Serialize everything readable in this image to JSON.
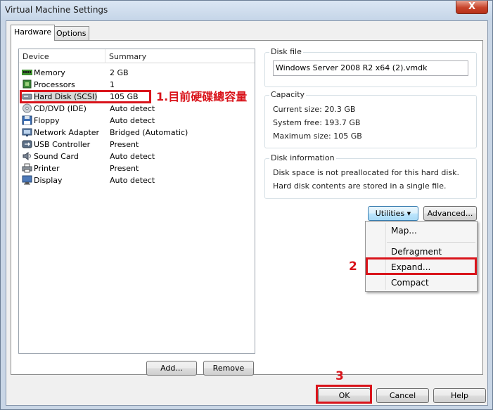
{
  "window": {
    "title": "Virtual Machine Settings",
    "close_label": "X"
  },
  "tabs": [
    {
      "label": "Hardware"
    },
    {
      "label": "Options"
    }
  ],
  "device_list": {
    "columns": {
      "device": "Device",
      "summary": "Summary"
    },
    "rows": [
      {
        "device": "Memory",
        "summary": "2 GB",
        "icon": "memory-icon"
      },
      {
        "device": "Processors",
        "summary": "1",
        "icon": "processor-icon"
      },
      {
        "device": "Hard Disk (SCSI)",
        "summary": "105 GB",
        "icon": "hard-disk-icon"
      },
      {
        "device": "CD/DVD (IDE)",
        "summary": "Auto detect",
        "icon": "cd-dvd-icon"
      },
      {
        "device": "Floppy",
        "summary": "Auto detect",
        "icon": "floppy-icon"
      },
      {
        "device": "Network Adapter",
        "summary": "Bridged (Automatic)",
        "icon": "network-adapter-icon"
      },
      {
        "device": "USB Controller",
        "summary": "Present",
        "icon": "usb-icon"
      },
      {
        "device": "Sound Card",
        "summary": "Auto detect",
        "icon": "sound-card-icon"
      },
      {
        "device": "Printer",
        "summary": "Present",
        "icon": "printer-icon"
      },
      {
        "device": "Display",
        "summary": "Auto detect",
        "icon": "display-icon"
      }
    ],
    "selected_index": 2
  },
  "annotations": {
    "step1": "1.目前硬碟總容量",
    "step2": "2",
    "step3": "3",
    "color": "#d9141b"
  },
  "disk_file": {
    "label": "Disk file",
    "value": "Windows Server 2008 R2 x64 (2).vmdk"
  },
  "capacity": {
    "label": "Capacity",
    "current_size": "Current size: 20.3 GB",
    "system_free": "System free: 193.7 GB",
    "maximum_size": "Maximum size: 105 GB"
  },
  "disk_information": {
    "label": "Disk information",
    "line1": "Disk space is not preallocated for this hard disk.",
    "line2": "Hard disk contents are stored in a single file."
  },
  "buttons": {
    "utilities": "Utilities ▾",
    "advanced": "Advanced...",
    "add": "Add...",
    "remove": "Remove",
    "ok": "OK",
    "cancel": "Cancel",
    "help": "Help"
  },
  "utilities_menu": {
    "items": [
      "Map...",
      "Defragment",
      "Expand...",
      "Compact"
    ],
    "highlighted": "Expand..."
  }
}
